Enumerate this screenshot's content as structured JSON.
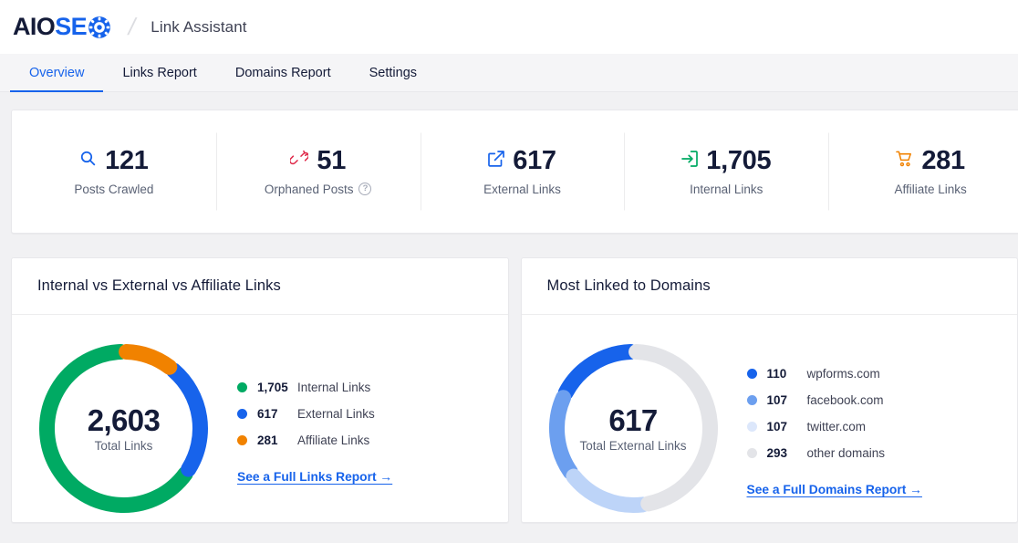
{
  "header": {
    "logo_aio": "AIO",
    "logo_se": "SE",
    "logo_icon": "gear-o-icon",
    "separator": "/",
    "page_title": "Link Assistant"
  },
  "tabs": [
    {
      "label": "Overview",
      "active": true
    },
    {
      "label": "Links Report",
      "active": false
    },
    {
      "label": "Domains Report",
      "active": false
    },
    {
      "label": "Settings",
      "active": false
    }
  ],
  "stats": [
    {
      "icon": "search-icon",
      "value": "121",
      "label": "Posts Crawled",
      "color": "#1763eb",
      "help": false
    },
    {
      "icon": "broken-link-icon",
      "value": "51",
      "label": "Orphaned Posts",
      "color": "#df2a4a",
      "help": true,
      "help_glyph": "?"
    },
    {
      "icon": "external-link-icon",
      "value": "617",
      "label": "External Links",
      "color": "#1763eb",
      "help": false
    },
    {
      "icon": "internal-link-icon",
      "value": "1,705",
      "label": "Internal Links",
      "color": "#00aa63",
      "help": false
    },
    {
      "icon": "cart-icon",
      "value": "281",
      "label": "Affiliate Links",
      "color": "#f18200",
      "help": false
    }
  ],
  "cards": [
    {
      "title": "Internal vs External vs Affiliate Links",
      "center_value": "2,603",
      "center_label": "Total Links",
      "link_label": "See a Full Links Report →"
    },
    {
      "title": "Most Linked to Domains",
      "center_value": "617",
      "center_label": "Total External Links",
      "link_label": "See a Full Domains Report →"
    }
  ],
  "chart_data": [
    {
      "type": "pie",
      "title": "Internal vs External vs Affiliate Links",
      "variant": "donut",
      "total": 2603,
      "total_label": "Total Links",
      "legend_position": "right",
      "categories": [
        "Internal Links",
        "External Links",
        "Affiliate Links"
      ],
      "values": [
        1705,
        617,
        281
      ],
      "display_values": [
        "1,705",
        "617",
        "281"
      ],
      "colors": [
        "#00aa63",
        "#1763eb",
        "#f18200"
      ],
      "percentages": [
        65.5,
        23.7,
        10.8
      ]
    },
    {
      "type": "pie",
      "title": "Most Linked to Domains",
      "variant": "donut",
      "total": 617,
      "total_label": "Total External Links",
      "legend_position": "right",
      "categories": [
        "wpforms.com",
        "facebook.com",
        "twitter.com",
        "other domains"
      ],
      "values": [
        110,
        107,
        107,
        293
      ],
      "display_values": [
        "110",
        "107",
        "107",
        "293"
      ],
      "colors": [
        "#1763eb",
        "#6c9fef",
        "#bdd4f8",
        "#e3e4e8"
      ],
      "percentages": [
        17.8,
        17.3,
        17.3,
        47.5
      ]
    }
  ]
}
